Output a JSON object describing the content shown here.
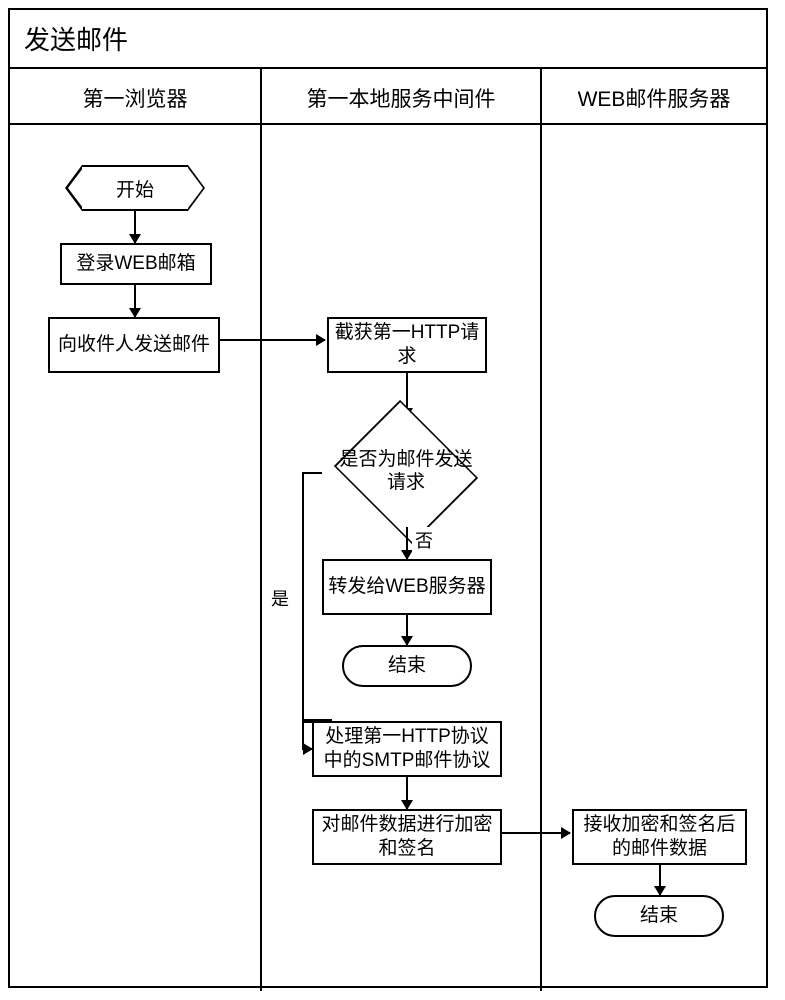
{
  "title": "发送邮件",
  "lanes": {
    "l1": "第一浏览器",
    "l2": "第一本地服务中间件",
    "l3": "WEB邮件服务器"
  },
  "nodes": {
    "start": "开始",
    "login": "登录WEB邮箱",
    "send_mail": "向收件人发送邮件",
    "intercept": "截获第一HTTP请求",
    "decision": "是否为邮件发送请求",
    "forward": "转发给WEB服务器",
    "end1": "结束",
    "process_smtp": "处理第一HTTP协议中的SMTP邮件协议",
    "encrypt": "对邮件数据进行加密和签名",
    "receive": "接收加密和签名后的邮件数据",
    "end2": "结束"
  },
  "edges": {
    "yes": "是",
    "no": "否"
  }
}
